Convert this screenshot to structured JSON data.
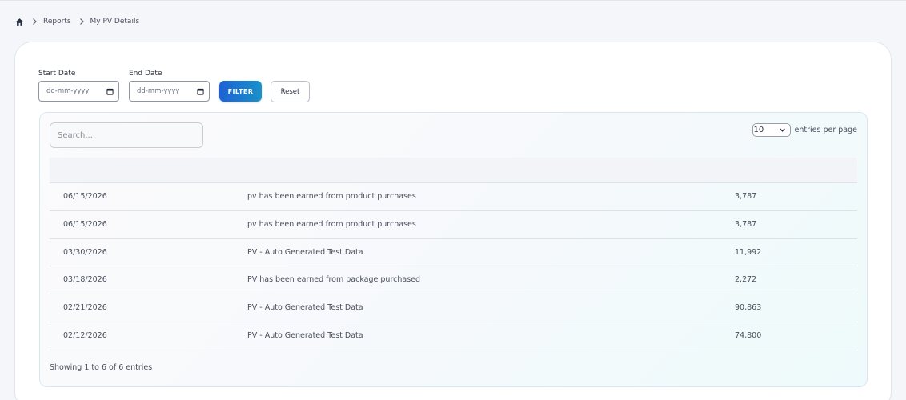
{
  "breadcrumb": {
    "home_icon": "home-icon",
    "items": [
      "Reports",
      "My PV Details"
    ]
  },
  "filters": {
    "start_label": "Start Date",
    "start_placeholder": "dd-mm-yyyy",
    "end_label": "End Date",
    "end_placeholder": "dd-mm-yyyy",
    "filter_label": "FILTER",
    "reset_label": "Reset"
  },
  "table_controls": {
    "search_placeholder": "Search...",
    "entries_value": "10",
    "entries_label": "entries per page"
  },
  "table": {
    "rows": [
      {
        "date": "06/15/2026",
        "description": "pv has been earned from product purchases",
        "pv": "3,787"
      },
      {
        "date": "06/15/2026",
        "description": "pv has been earned from product purchases",
        "pv": "3,787"
      },
      {
        "date": "03/30/2026",
        "description": "PV - Auto Generated Test Data",
        "pv": "11,992"
      },
      {
        "date": "03/18/2026",
        "description": "PV has been earned from package purchased",
        "pv": "2,272"
      },
      {
        "date": "02/21/2026",
        "description": "PV - Auto Generated Test Data",
        "pv": "90,863"
      },
      {
        "date": "02/12/2026",
        "description": "PV - Auto Generated Test Data",
        "pv": "74,800"
      }
    ],
    "info": "Showing 1 to 6 of 6 entries"
  },
  "colors": {
    "accent_start": "#1c62d4",
    "accent_end": "#1a92c9",
    "page_bg": "#f4f6f9"
  }
}
